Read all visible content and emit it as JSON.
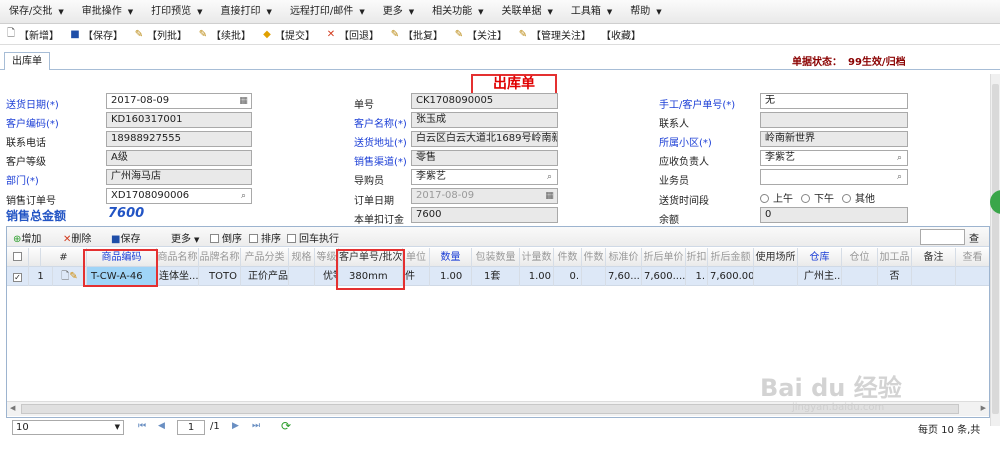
{
  "menu": [
    {
      "label": "保存/交批"
    },
    {
      "label": "审批操作"
    },
    {
      "label": "打印预览"
    },
    {
      "label": "直接打印"
    },
    {
      "label": "远程打印/邮件"
    },
    {
      "label": "更多"
    },
    {
      "label": "相关功能"
    },
    {
      "label": "关联单据"
    },
    {
      "label": "工具箱"
    },
    {
      "label": "帮助"
    }
  ],
  "toolbar": [
    {
      "label": "【新增】",
      "icon": "document-icon"
    },
    {
      "label": "【保存】",
      "icon": "save-icon"
    },
    {
      "label": "【列批】",
      "icon": "check-icon"
    },
    {
      "label": "【续批】",
      "icon": "check-icon"
    },
    {
      "label": "【提交】",
      "icon": "submit-icon"
    },
    {
      "label": "【回退】",
      "icon": "x-icon"
    },
    {
      "label": "【批复】",
      "icon": "edit-icon"
    },
    {
      "label": "【关注】",
      "icon": "check-icon"
    },
    {
      "label": "【管理关注】",
      "icon": "check-icon"
    },
    {
      "label": "【收藏】",
      "icon": ""
    }
  ],
  "tab": {
    "label": "出库单"
  },
  "status": {
    "label": "单据状态：",
    "value": "99生效/归档"
  },
  "form_title": "出库单",
  "form": {
    "send_date_label": "送货日期(*)",
    "send_date": "2017-08-09",
    "doc_no_label": "单号",
    "doc_no": "CK1708090005",
    "manual_no_label": "手工/客户单号(*)",
    "manual_no": "无",
    "cust_code_label": "客户编码(*)",
    "cust_code": "KD160317001",
    "cust_name_label": "客户名称(*)",
    "cust_name": "张玉成",
    "contact_label": "联系人",
    "contact": "",
    "phone_label": "联系电话",
    "phone": "18988927555",
    "address_label": "送货地址(*)",
    "address": "白云区白云大道北1689号岭南新世",
    "district_label": "所属小区(*)",
    "district": "岭南新世界",
    "level_label": "客户等级",
    "level": "A级",
    "channel_label": "销售渠道(*)",
    "channel": "零售",
    "ar_label": "应收负责人",
    "ar": "李紫艺",
    "dept_label": "部门(*)",
    "dept": "广州海马店",
    "guide_label": "导购员",
    "guide": "李紫艺",
    "sales_label": "业务员",
    "sales": "",
    "order_no_label": "销售订单号",
    "order_no": "XD1708090006",
    "order_date_label": "订单日期",
    "order_date": "2017-08-09",
    "time_label": "送货时间段",
    "time_options": [
      "上午",
      "下午",
      "其他"
    ],
    "total_label": "销售总金额",
    "total": "7600",
    "deposit_label": "本单扣订金",
    "deposit": "7600",
    "balance_label": "余额",
    "balance": "0"
  },
  "grid_toolbar": {
    "add": "增加",
    "delete": "删除",
    "save": "保存",
    "more": "更多",
    "reverse": "倒序",
    "sort": "排序",
    "enter": "回车执行",
    "search_btn": "查"
  },
  "columns": [
    "#",
    "商品编码",
    "商品名称",
    "品牌名称",
    "产品分类",
    "规格",
    "等级",
    "客户单号/批次",
    "单位",
    "数量",
    "包装数量",
    "计量数",
    "件数",
    "件数",
    "标准价",
    "折后单价",
    "折扣",
    "折后金额",
    "使用场所",
    "仓库",
    "仓位",
    "加工品",
    "备注",
    "查看"
  ],
  "rows": [
    {
      "no": "1",
      "code": "T-CW-A-46",
      "name": "连体坐...",
      "brand": "TOTO",
      "category": "正价产品",
      "spec": "",
      "grade": "优等",
      "batch": "380mm",
      "unit": "件",
      "qty": "1.00",
      "pack": "1套",
      "measure": "1.00",
      "pieces": "0.",
      "std_price": "7,60...",
      "disc_price": "7,600....",
      "discount": "1.",
      "amount": "7,600.00",
      "place": "",
      "warehouse": "广州主...",
      "location": "",
      "processed": "否",
      "remark": ""
    }
  ],
  "pager": {
    "page_size": "10",
    "page": "1",
    "total_pages": "/1",
    "info": "每页 10 条,共"
  },
  "watermark": {
    "brand": "Bai du 经验",
    "url": "jingyan.baidu.com"
  }
}
